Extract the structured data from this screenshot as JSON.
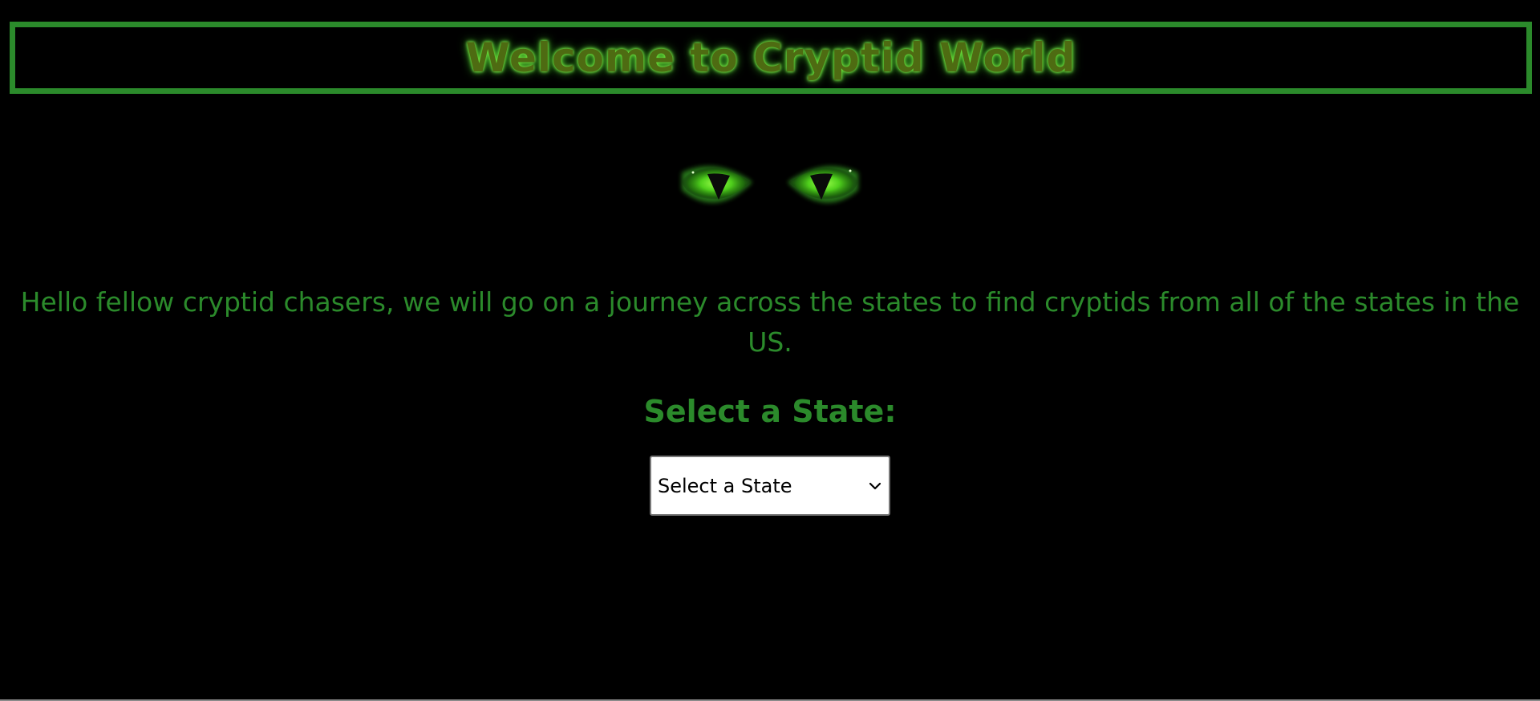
{
  "header": {
    "title": "Welcome to Cryptid World"
  },
  "hero": {
    "icon": "glowing-green-eyes"
  },
  "intro": {
    "text": "Hello fellow cryptid chasers, we will go on a journey across the states to find cryptids from all of the states in the US."
  },
  "state_selector": {
    "label": "Select a State:",
    "selected_value": "Select a State",
    "icon": "chevron-down-icon"
  },
  "colors": {
    "background": "#000000",
    "accent_green": "#2b8a2b",
    "title_text": "#4e6b12",
    "glow": "#6fe33a"
  }
}
